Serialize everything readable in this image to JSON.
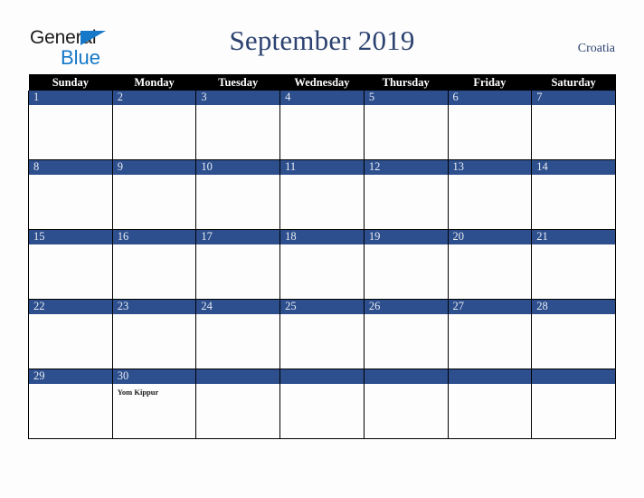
{
  "brand": {
    "word_one": "General",
    "word_two": "Blue",
    "triangle_icon": "triangle-right-icon",
    "accent_color": "#1578c8"
  },
  "header": {
    "title": "September 2019",
    "country": "Croatia",
    "title_color": "#2c4270"
  },
  "calendar": {
    "weekday_headers": [
      "Sunday",
      "Monday",
      "Tuesday",
      "Wednesday",
      "Thursday",
      "Friday",
      "Saturday"
    ],
    "header_bg": "#000000",
    "date_bar_color": "#2d4f8e",
    "cell_bg": "#fdfdfd",
    "weeks": [
      [
        {
          "day": "1",
          "events": []
        },
        {
          "day": "2",
          "events": []
        },
        {
          "day": "3",
          "events": []
        },
        {
          "day": "4",
          "events": []
        },
        {
          "day": "5",
          "events": []
        },
        {
          "day": "6",
          "events": []
        },
        {
          "day": "7",
          "events": []
        }
      ],
      [
        {
          "day": "8",
          "events": []
        },
        {
          "day": "9",
          "events": []
        },
        {
          "day": "10",
          "events": []
        },
        {
          "day": "11",
          "events": []
        },
        {
          "day": "12",
          "events": []
        },
        {
          "day": "13",
          "events": []
        },
        {
          "day": "14",
          "events": []
        }
      ],
      [
        {
          "day": "15",
          "events": []
        },
        {
          "day": "16",
          "events": []
        },
        {
          "day": "17",
          "events": []
        },
        {
          "day": "18",
          "events": []
        },
        {
          "day": "19",
          "events": []
        },
        {
          "day": "20",
          "events": []
        },
        {
          "day": "21",
          "events": []
        }
      ],
      [
        {
          "day": "22",
          "events": []
        },
        {
          "day": "23",
          "events": []
        },
        {
          "day": "24",
          "events": []
        },
        {
          "day": "25",
          "events": []
        },
        {
          "day": "26",
          "events": []
        },
        {
          "day": "27",
          "events": []
        },
        {
          "day": "28",
          "events": []
        }
      ],
      [
        {
          "day": "29",
          "events": []
        },
        {
          "day": "30",
          "events": [
            "Yom Kippur"
          ]
        },
        {
          "day": "",
          "events": []
        },
        {
          "day": "",
          "events": []
        },
        {
          "day": "",
          "events": []
        },
        {
          "day": "",
          "events": []
        },
        {
          "day": "",
          "events": []
        }
      ]
    ]
  }
}
